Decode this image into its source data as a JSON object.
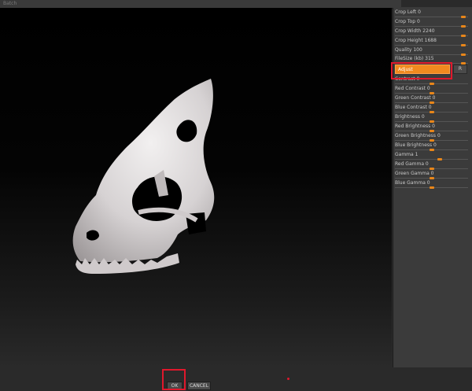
{
  "window": {
    "title": "Batch"
  },
  "params": [
    {
      "label": "Crop Left 0",
      "level": 0.95
    },
    {
      "label": "Crop Top 0",
      "level": 0.95
    },
    {
      "label": "Crop Width 2240",
      "level": 0.95
    },
    {
      "label": "Crop Height 1688",
      "level": 0.95
    },
    {
      "label": "Quality 100",
      "level": 0.95
    },
    {
      "label": "FileSize (kb) 315",
      "level": 0.95
    }
  ],
  "adjust": {
    "label": "Adjust",
    "side_label": "R"
  },
  "color_params": [
    {
      "label": "Contrast 0",
      "level": 0.5
    },
    {
      "label": "Red Contrast 0",
      "level": 0.5
    },
    {
      "label": "Green Contrast 0",
      "level": 0.5
    },
    {
      "label": "Blue Contrast 0",
      "level": 0.5
    },
    {
      "label": "Brightness 0",
      "level": 0.5
    },
    {
      "label": "Red Brightness 0",
      "level": 0.5
    },
    {
      "label": "Green Brightness 0",
      "level": 0.5
    },
    {
      "label": "Blue Brightness 0",
      "level": 0.5
    },
    {
      "label": "Gamma 1",
      "level": 0.6
    },
    {
      "label": "Red Gamma 0",
      "level": 0.5
    },
    {
      "label": "Green Gamma 0",
      "level": 0.5
    },
    {
      "label": "Blue Gamma 0",
      "level": 0.5
    }
  ],
  "footer": {
    "ok_label": "OK",
    "cancel_label": "CANCEL"
  },
  "colors": {
    "accent": "#f18a1f",
    "highlight": "#e0182c"
  }
}
